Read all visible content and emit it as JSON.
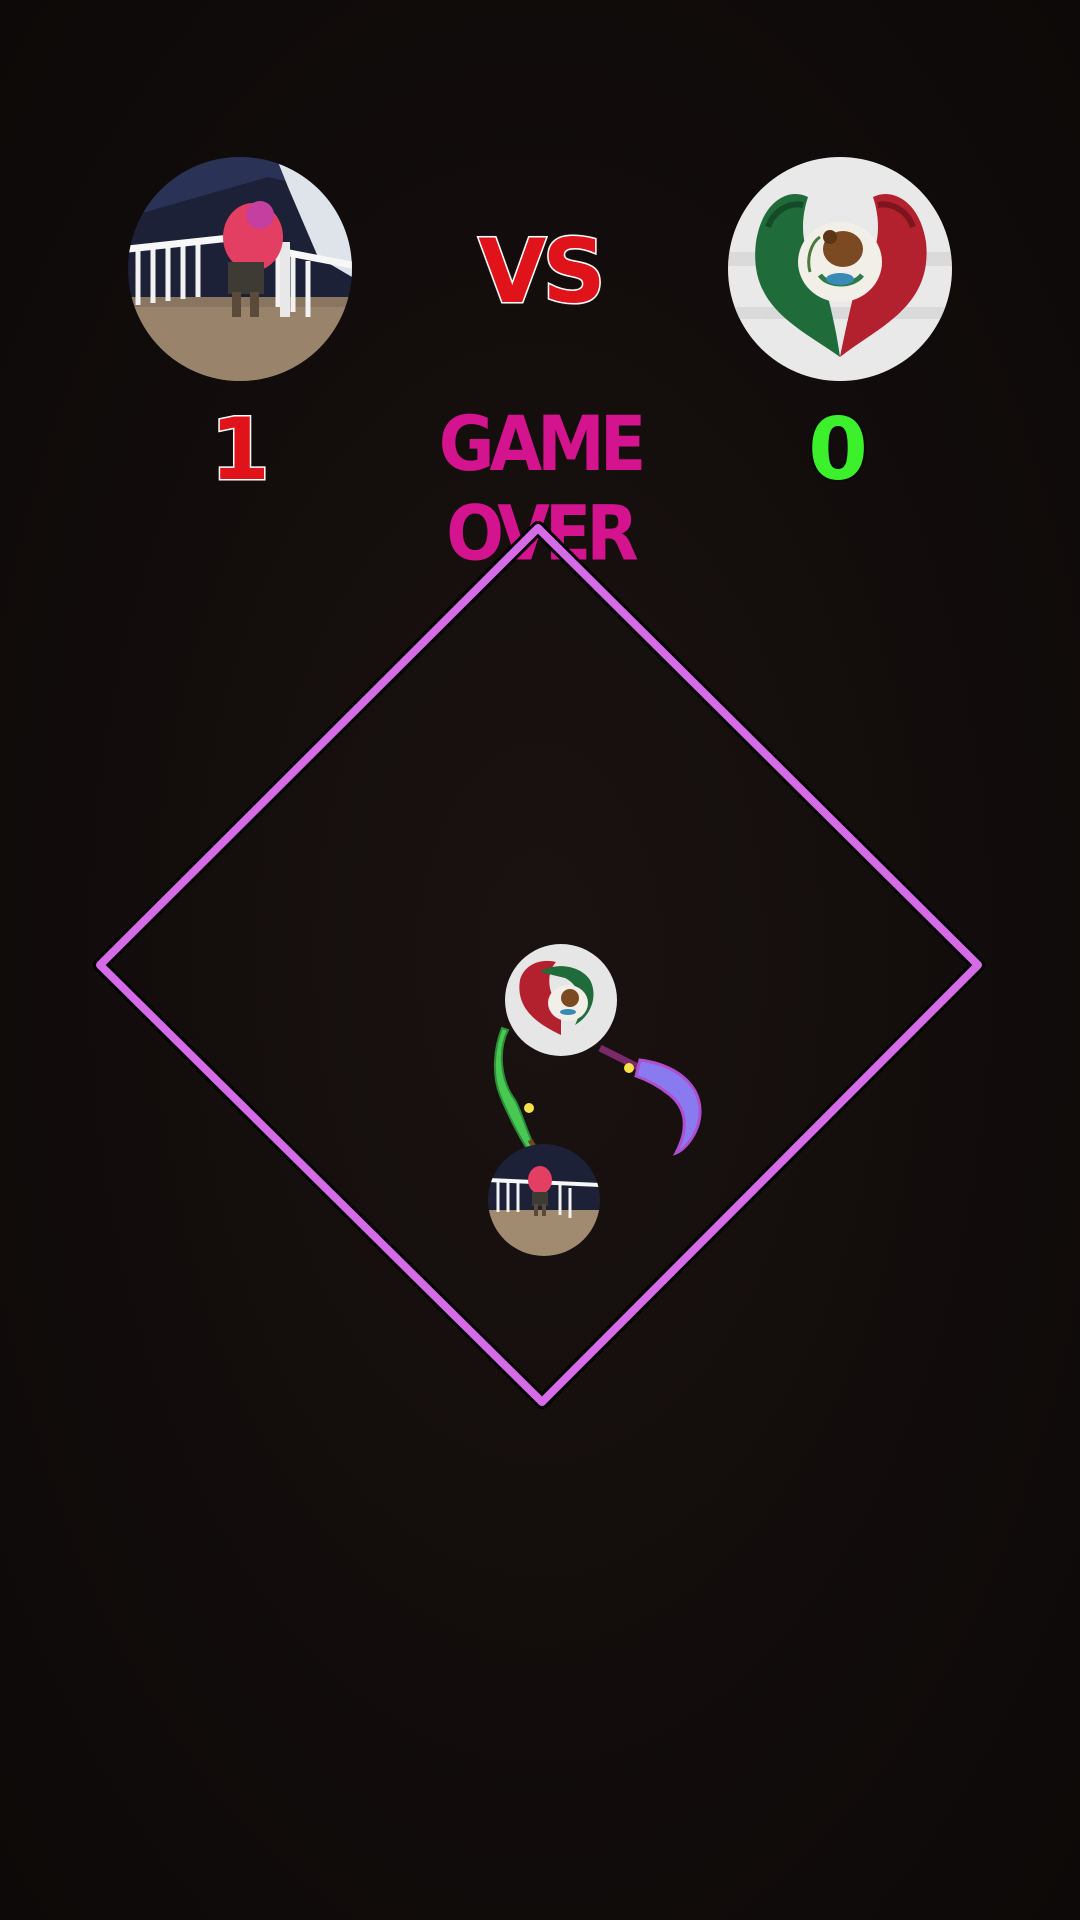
{
  "header": {
    "vs_label": "VS",
    "status_label": "GAME OVER"
  },
  "players": [
    {
      "side": "left",
      "score": "1",
      "score_color": "#e0131a",
      "avatar": "person-on-balcony-photo",
      "weapon": "green-sword"
    },
    {
      "side": "right",
      "score": "0",
      "score_color": "#3cf02b",
      "avatar": "mexican-eagle-emblem",
      "weapon": "blue-purple-scythe"
    }
  ],
  "arena": {
    "shape": "diamond",
    "border_color": "#d66be8"
  },
  "colors": {
    "background": "#120d0c",
    "vs_red": "#e0131a",
    "game_over_magenta": "#d4138f"
  }
}
